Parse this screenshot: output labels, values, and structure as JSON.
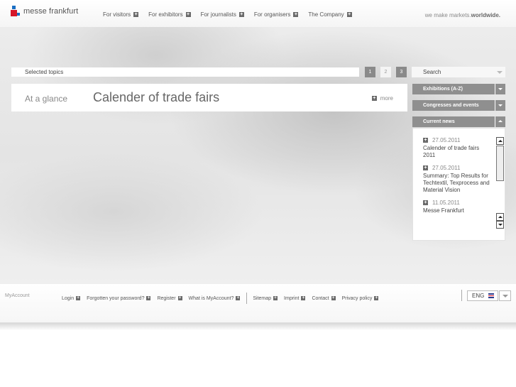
{
  "header": {
    "logo_text": "messe frankfurt",
    "nav": [
      {
        "label": "For visitors"
      },
      {
        "label": "For exhibitors"
      },
      {
        "label": "For journalists"
      },
      {
        "label": "For organisers"
      },
      {
        "label": "The Company"
      }
    ],
    "tagline_prefix": "we make markets.",
    "tagline_bold": "worldwide."
  },
  "topics": {
    "label": "Selected topics"
  },
  "pager": [
    "1",
    "2",
    "3"
  ],
  "glance": {
    "label": "At a glance",
    "title": "Calender of trade fairs",
    "more": "more"
  },
  "sidebar": {
    "search_label": "Search",
    "accordion": [
      {
        "label": "Exhibitions (A-Z)"
      },
      {
        "label": "Congresses and events"
      },
      {
        "label": "Current news"
      }
    ],
    "news": [
      {
        "date": "27.05.2011",
        "text": "Calender of trade fairs 2011"
      },
      {
        "date": "27.05.2011",
        "text": "Summary: Top Results for Techtextil, Texprocess and Material Vision"
      },
      {
        "date": "11.05.2011",
        "text": "Messe Frankfurt"
      }
    ]
  },
  "footer": {
    "myaccount": "MyAccount",
    "links_left": [
      {
        "label": "Login"
      },
      {
        "label": "Forgotten your password?"
      },
      {
        "label": "Register"
      },
      {
        "label": "What is MyAccount?"
      }
    ],
    "links_right": [
      {
        "label": "Sitemap"
      },
      {
        "label": "Imprint"
      },
      {
        "label": "Contact"
      },
      {
        "label": "Privacy policy"
      }
    ],
    "language": "ENG"
  },
  "colors": {
    "accent_red": "#d6172a",
    "accent_blue": "#1a6fc4",
    "bar_gray": "#8f8f8f"
  }
}
